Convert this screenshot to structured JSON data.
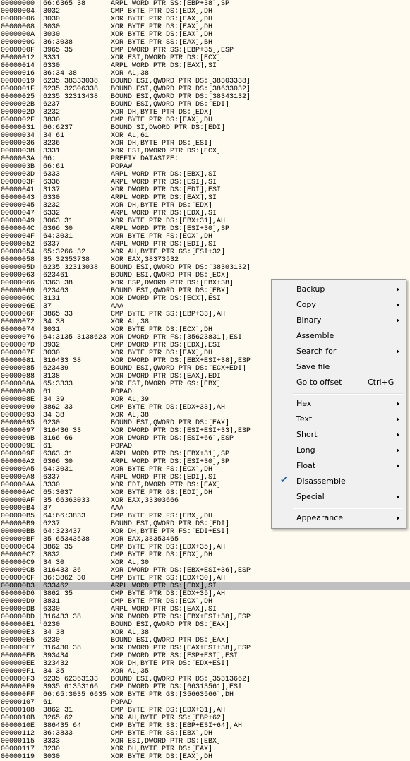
{
  "rows": [
    [
      "00000000",
      "66:6365 38",
      "ARPL WORD PTR SS:[EBP+38],SP"
    ],
    [
      "00000004",
      "3032",
      "CMP BYTE PTR DS:[EDX],DH"
    ],
    [
      "00000006",
      "3030",
      "XOR BYTE PTR DS:[EAX],DH"
    ],
    [
      "00000008",
      "3030",
      "XOR BYTE PTR DS:[EAX],DH"
    ],
    [
      "0000000A",
      "3030",
      "XOR BYTE PTR DS:[EAX],DH"
    ],
    [
      "0000000C",
      "36:3038",
      "XOR BYTE PTR SS:[EAX],BH"
    ],
    [
      "0000000F",
      "3965 35",
      "CMP DWORD PTR SS:[EBP+35],ESP"
    ],
    [
      "00000012",
      "3331",
      "XOR ESI,DWORD PTR DS:[ECX]"
    ],
    [
      "00000014",
      "6330",
      "ARPL WORD PTR DS:[EAX],SI"
    ],
    [
      "00000016",
      "36:34 38",
      "XOR AL,38"
    ],
    [
      "00000019",
      "6235 38333038",
      "BOUND ESI,QWORD PTR DS:[38303338]"
    ],
    [
      "0000001F",
      "6235 32306338",
      "BOUND ESI,QWORD PTR DS:[38633032]"
    ],
    [
      "00000025",
      "6235 32313438",
      "BOUND ESI,QWORD PTR DS:[38343132]"
    ],
    [
      "0000002B",
      "6237",
      "BOUND ESI,QWORD PTR DS:[EDI]"
    ],
    [
      "0000002D",
      "3232",
      "XOR DH,BYTE PTR DS:[EDX]"
    ],
    [
      "0000002F",
      "3830",
      "CMP BYTE PTR DS:[EAX],DH"
    ],
    [
      "00000031",
      "66:6237",
      "BOUND SI,DWORD PTR DS:[EDI]"
    ],
    [
      "00000034",
      "34 61",
      "XOR AL,61"
    ],
    [
      "00000036",
      "3236",
      "XOR DH,BYTE PTR DS:[ESI]"
    ],
    [
      "00000038",
      "3331",
      "XOR ESI,DWORD PTR DS:[ECX]"
    ],
    [
      "0000003A",
      "66:",
      "PREFIX DATASIZE:"
    ],
    [
      "0000003B",
      "66:61",
      "POPAW"
    ],
    [
      "0000003D",
      "6333",
      "ARPL WORD PTR DS:[EBX],SI"
    ],
    [
      "0000003F",
      "6336",
      "ARPL WORD PTR DS:[ESI],SI"
    ],
    [
      "00000041",
      "3137",
      "XOR DWORD PTR DS:[EDI],ESI"
    ],
    [
      "00000043",
      "6330",
      "ARPL WORD PTR DS:[EAX],SI"
    ],
    [
      "00000045",
      "3232",
      "XOR DH,BYTE PTR DS:[EDX]"
    ],
    [
      "00000047",
      "6332",
      "ARPL WORD PTR DS:[EDX],SI"
    ],
    [
      "00000049",
      "3063 31",
      "XOR BYTE PTR DS:[EBX+31],AH"
    ],
    [
      "0000004C",
      "6366 30",
      "ARPL WORD PTR DS:[ESI+30],SP"
    ],
    [
      "0000004F",
      "64:3031",
      "XOR BYTE PTR FS:[ECX],DH"
    ],
    [
      "00000052",
      "6337",
      "ARPL WORD PTR DS:[EDI],SI"
    ],
    [
      "00000054",
      "65:3266 32",
      "XOR AH,BYTE PTR GS:[ESI+32]"
    ],
    [
      "00000058",
      "35 32353738",
      "XOR EAX,38373532"
    ],
    [
      "0000005D",
      "6235 32313038",
      "BOUND ESI,QWORD PTR DS:[38303132]"
    ],
    [
      "00000063",
      "623461",
      "BOUND ESI,QWORD PTR DS:[ECX]"
    ],
    [
      "00000066",
      "3363 38",
      "XOR ESP,DWORD PTR DS:[EBX+38]"
    ],
    [
      "00000069",
      "623463",
      "BOUND ESI,QWORD PTR DS:[EBX]"
    ],
    [
      "0000006C",
      "3131",
      "XOR DWORD PTR DS:[ECX],ESI"
    ],
    [
      "0000006E",
      "37",
      "AAA"
    ],
    [
      "0000006F",
      "3865 33",
      "CMP BYTE PTR SS:[EBP+33],AH"
    ],
    [
      "00000072",
      "34 38",
      "XOR AL,38"
    ],
    [
      "00000074",
      "3031",
      "XOR BYTE PTR DS:[ECX],DH"
    ],
    [
      "00000076",
      "64:3135 3138623",
      "XOR DWORD PTR FS:[35623831],ESI"
    ],
    [
      "0000007D",
      "3932",
      "CMP DWORD PTR DS:[EDX],ESI"
    ],
    [
      "0000007F",
      "3030",
      "XOR BYTE PTR DS:[EAX],DH"
    ],
    [
      "00000081",
      "316433 38",
      "XOR DWORD PTR DS:[EBX+ESI+38],ESP"
    ],
    [
      "00000085",
      "623439",
      "BOUND ESI,QWORD PTR DS:[ECX+EDI]"
    ],
    [
      "00000088",
      "3138",
      "XOR DWORD PTR DS:[EAX],EDI"
    ],
    [
      "0000008A",
      "65:3333",
      "XOR ESI,DWORD PTR GS:[EBX]"
    ],
    [
      "0000008D",
      "61",
      "POPAD"
    ],
    [
      "0000008E",
      "34 39",
      "XOR AL,39"
    ],
    [
      "00000090",
      "3862 33",
      "CMP BYTE PTR DS:[EDX+33],AH"
    ],
    [
      "00000093",
      "34 38",
      "XOR AL,38"
    ],
    [
      "00000095",
      "6230",
      "BOUND ESI,QWORD PTR DS:[EAX]"
    ],
    [
      "00000097",
      "316436 33",
      "XOR DWORD PTR DS:[ESI+ESI+33],ESP"
    ],
    [
      "0000009B",
      "3166 66",
      "XOR DWORD PTR DS:[ESI+66],ESP"
    ],
    [
      "0000009E",
      "61",
      "POPAD"
    ],
    [
      "0000009F",
      "6363 31",
      "ARPL WORD PTR DS:[EBX+31],SP"
    ],
    [
      "000000A2",
      "6366 30",
      "ARPL WORD PTR DS:[ESI+30],SP"
    ],
    [
      "000000A5",
      "64:3031",
      "XOR BYTE PTR FS:[ECX],DH"
    ],
    [
      "000000A8",
      "6337",
      "ARPL WORD PTR DS:[EDI],SI"
    ],
    [
      "000000AA",
      "3330",
      "XOR EDI,DWORD PTR DS:[EAX]"
    ],
    [
      "000000AC",
      "65:3037",
      "XOR BYTE PTR GS:[EDI],DH"
    ],
    [
      "000000AF",
      "35 66363033",
      "XOR EAX,33303666"
    ],
    [
      "000000B4",
      "37",
      "AAA"
    ],
    [
      "000000B5",
      "64:66:3833",
      "CMP BYTE PTR FS:[EBX],DH"
    ],
    [
      "000000B9",
      "6237",
      "BOUND ESI,QWORD PTR DS:[EDI]"
    ],
    [
      "000000BB",
      "64:323437",
      "XOR DH,BYTE PTR FS:[EDI+ESI]"
    ],
    [
      "000000BF",
      "35 65343538",
      "XOR EAX,38353465"
    ],
    [
      "000000C4",
      "3862 35",
      "CMP BYTE PTR DS:[EDX+35],AH"
    ],
    [
      "000000C7",
      "3832",
      "CMP BYTE PTR DS:[EDX],DH"
    ],
    [
      "000000C9",
      "34 30",
      "XOR AL,30"
    ],
    [
      "000000CB",
      "316433 36",
      "XOR DWORD PTR DS:[EBX+ESI+36],ESP"
    ],
    [
      "000000CF",
      "36:3862 30",
      "CMP BYTE PTR SS:[EDX+30],AH"
    ],
    [
      "000000D3",
      "633462",
      "ARPL WORD PTR DS:[EDX],SI"
    ],
    [
      "000000D6",
      "3862 35",
      "CMP BYTE PTR DS:[EDX+35],AH"
    ],
    [
      "000000D9",
      "3831",
      "CMP BYTE PTR DS:[ECX],DH"
    ],
    [
      "000000DB",
      "6330",
      "ARPL WORD PTR DS:[EAX],SI"
    ],
    [
      "000000DD",
      "316433 38",
      "XOR DWORD PTR DS:[EBX+ESI+38],ESP"
    ],
    [
      "000000E1",
      "6230",
      "BOUND ESI,QWORD PTR DS:[EAX]"
    ],
    [
      "000000E3",
      "34 38",
      "XOR AL,38"
    ],
    [
      "000000E5",
      "6230",
      "BOUND ESI,QWORD PTR DS:[EAX]"
    ],
    [
      "000000E7",
      "316430 38",
      "XOR DWORD PTR DS:[EAX+ESI+38],ESP"
    ],
    [
      "000000EB",
      "393434",
      "CMP DWORD PTR SS:[ESP+ESI],ESI"
    ],
    [
      "000000EE",
      "323432",
      "XOR DH,BYTE PTR DS:[EDX+ESI]"
    ],
    [
      "000000F1",
      "34 35",
      "XOR AL,35"
    ],
    [
      "000000F3",
      "6235 62363133",
      "BOUND ESI,QWORD PTR DS:[35313662]"
    ],
    [
      "000000F9",
      "3935 61353166",
      "CMP DWORD PTR DS:[66313561],ESI"
    ],
    [
      "000000FF",
      "66:65:3035 6635",
      "XOR BYTE PTR GS:[35663566],DH"
    ],
    [
      "00000107",
      "61",
      "POPAD"
    ],
    [
      "00000108",
      "3862 31",
      "CMP BYTE PTR DS:[EDX+31],AH"
    ],
    [
      "0000010B",
      "3265 62",
      "XOR AH,BYTE PTR SS:[EBP+62]"
    ],
    [
      "0000010E",
      "386435 64",
      "CMP BYTE PTR SS:[EBP+ESI+64],AH"
    ],
    [
      "00000112",
      "36:3833",
      "CMP BYTE PTR SS:[EBX],DH"
    ],
    [
      "00000115",
      "3333",
      "XOR ESI,DWORD PTR DS:[EBX]"
    ],
    [
      "00000117",
      "3230",
      "XOR DH,BYTE PTR DS:[EAX]"
    ],
    [
      "00000119",
      "3030",
      "XOR BYTE PTR DS:[EAX],DH"
    ]
  ],
  "selected_row_index": 75,
  "context_menu": {
    "items": [
      {
        "label": "Backup",
        "submenu": true
      },
      {
        "label": "Copy",
        "submenu": true
      },
      {
        "label": "Binary",
        "submenu": true
      },
      {
        "label": "Assemble"
      },
      {
        "label": "Search for",
        "submenu": true
      },
      {
        "label": "Save file"
      },
      {
        "label": "Go to offset",
        "shortcut": "Ctrl+G"
      },
      {
        "separator": true
      },
      {
        "label": "Hex",
        "submenu": true
      },
      {
        "label": "Text",
        "submenu": true
      },
      {
        "label": "Short",
        "submenu": true
      },
      {
        "label": "Long",
        "submenu": true
      },
      {
        "label": "Float",
        "submenu": true
      },
      {
        "label": "Disassemble",
        "checked": true
      },
      {
        "label": "Special",
        "submenu": true
      },
      {
        "separator": true
      },
      {
        "label": "Appearance",
        "submenu": true
      }
    ]
  },
  "colors": {
    "background": "#fffbf0",
    "selected_row": "#c0c0c0",
    "menu_background": "#f0f0f0",
    "check_mark": "#1e5aa8"
  }
}
